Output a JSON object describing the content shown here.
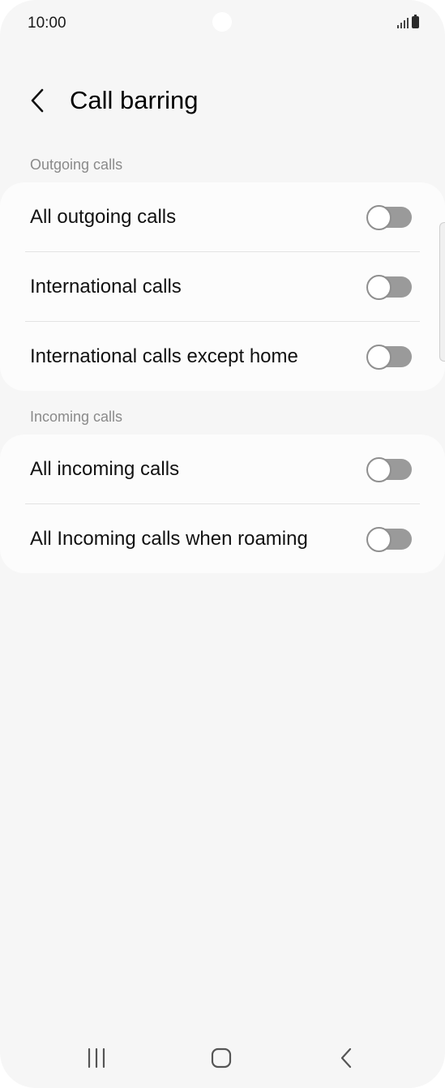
{
  "status_bar": {
    "time": "10:00",
    "icons": [
      "signal-icon",
      "battery-icon"
    ]
  },
  "header": {
    "title": "Call barring",
    "back_icon": "back-arrow-icon"
  },
  "sections": [
    {
      "label": "Outgoing calls",
      "items": [
        {
          "label": "All outgoing calls",
          "enabled": false
        },
        {
          "label": "International calls",
          "enabled": false
        },
        {
          "label": "International calls except home",
          "enabled": false
        }
      ]
    },
    {
      "label": "Incoming calls",
      "items": [
        {
          "label": "All incoming calls",
          "enabled": false
        },
        {
          "label": "All Incoming calls when roaming",
          "enabled": false
        }
      ]
    }
  ],
  "nav_bar": {
    "icons": [
      "recent-apps-icon",
      "home-icon",
      "back-icon"
    ]
  },
  "colors": {
    "background": "#f6f6f6",
    "card": "#fcfcfc",
    "toggle_off_track": "#9a9a9a",
    "section_label": "#8a8a8a"
  }
}
